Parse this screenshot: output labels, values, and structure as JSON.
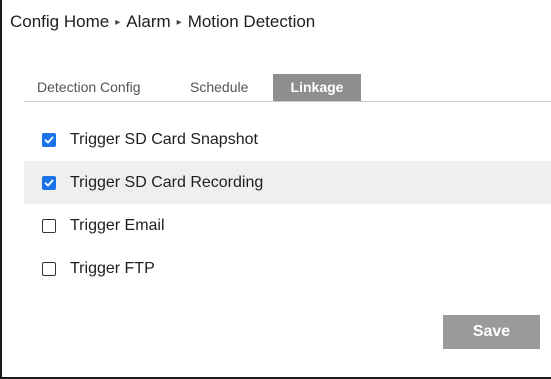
{
  "breadcrumb": {
    "items": [
      "Config Home",
      "Alarm",
      "Motion Detection"
    ],
    "separator": "▸"
  },
  "tabs": [
    {
      "label": "Detection Config",
      "active": false
    },
    {
      "label": "Schedule",
      "active": false
    },
    {
      "label": "Linkage",
      "active": true
    }
  ],
  "options": [
    {
      "label": "Trigger SD Card Snapshot",
      "checked": true
    },
    {
      "label": "Trigger SD Card Recording",
      "checked": true
    },
    {
      "label": "Trigger Email",
      "checked": false
    },
    {
      "label": "Trigger FTP",
      "checked": false
    }
  ],
  "actions": {
    "save_label": "Save"
  },
  "colors": {
    "accent": "#1a73e8",
    "active_tab": "#8e8e8e",
    "save_button": "#9a9a9a",
    "row_highlight": "#efefef"
  }
}
